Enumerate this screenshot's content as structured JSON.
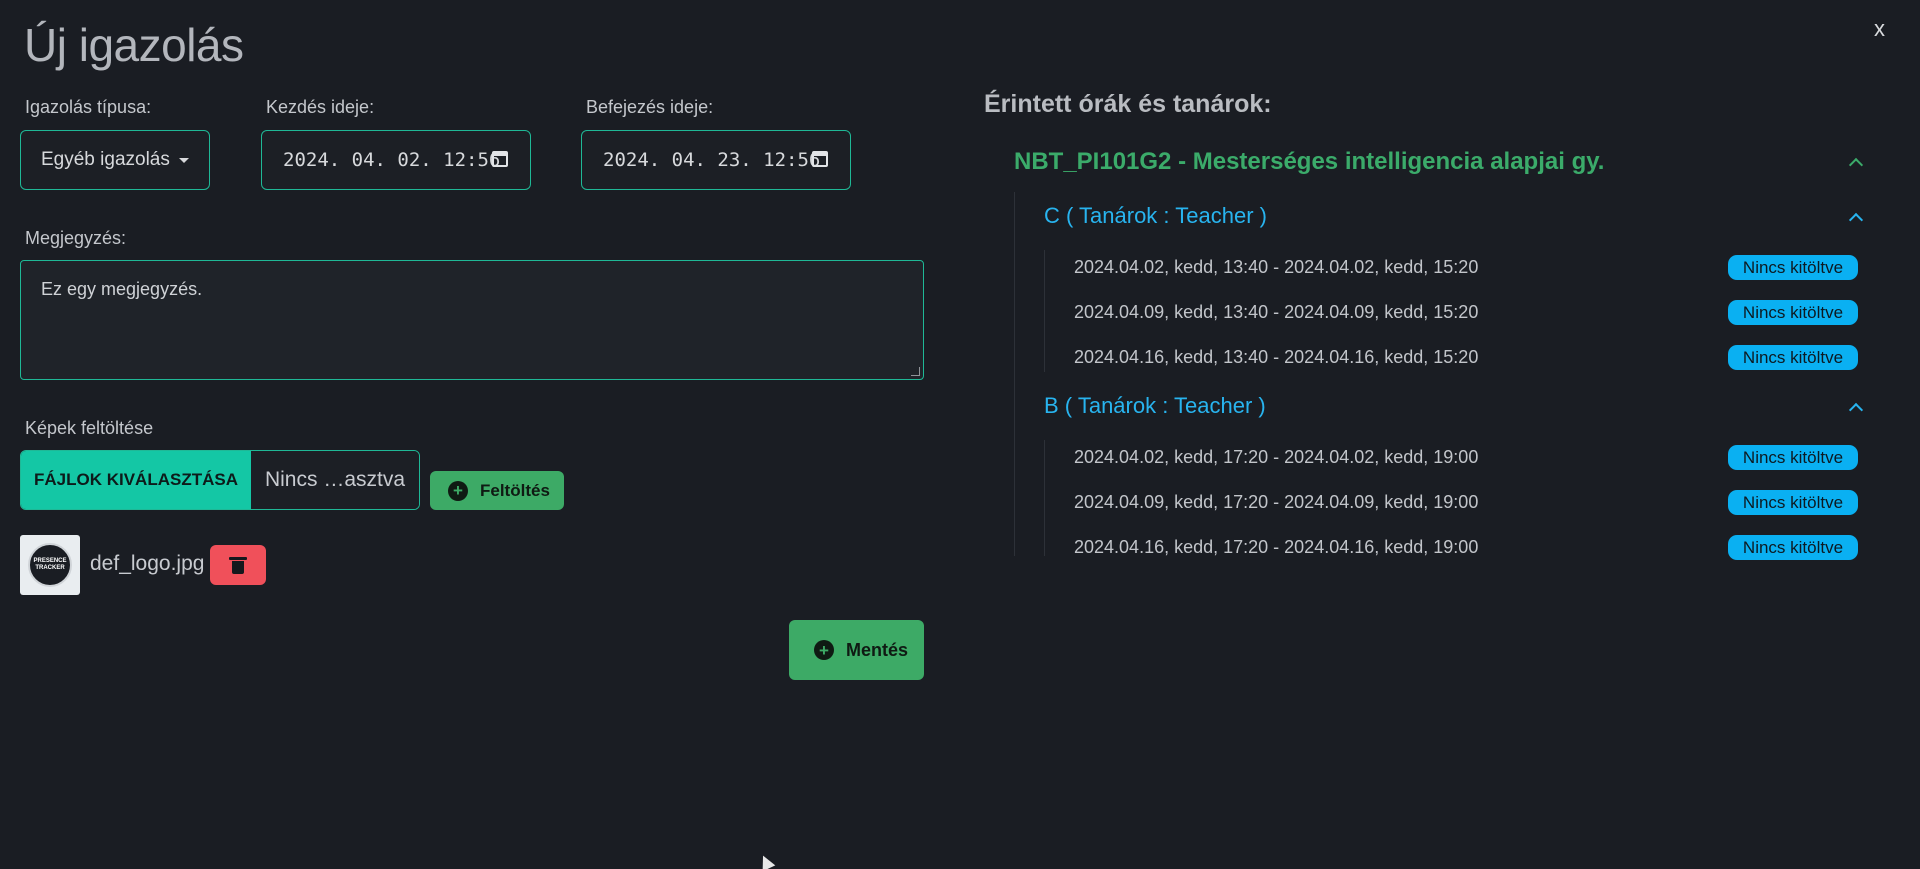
{
  "dialog": {
    "title": "Új igazolás",
    "close_label": "x"
  },
  "form": {
    "type_label": "Igazolás típusa:",
    "type_value": "Egyéb igazolás",
    "start_label": "Kezdés ideje:",
    "start_value": "2024. 04. 02. 12:56",
    "end_label": "Befejezés ideje:",
    "end_value": "2024. 04. 23. 12:56",
    "note_label": "Megjegyzés:",
    "note_value": "Ez egy megjegyzés."
  },
  "upload": {
    "section_label": "Képek feltöltése",
    "choose_button": "FÁJLOK KIVÁLASZTÁSA",
    "no_file_text": "Nincs …asztva",
    "upload_button": "Feltöltés",
    "files": [
      {
        "name": "def_logo.jpg",
        "logo_text_1": "PRESENCE",
        "logo_text_2": "TRACKER"
      }
    ]
  },
  "save_button": "Mentés",
  "affected": {
    "title": "Érintett órák és tanárok:",
    "course": "NBT_PI101G2 - Mesterséges intelligencia alapjai gy.",
    "groups": [
      {
        "title": "C ( Tanárok : Teacher )",
        "sessions": [
          {
            "text": "2024.04.02, kedd, 13:40 - 2024.04.02, kedd, 15:20",
            "status": "Nincs kitöltve"
          },
          {
            "text": "2024.04.09, kedd, 13:40 - 2024.04.09, kedd, 15:20",
            "status": "Nincs kitöltve"
          },
          {
            "text": "2024.04.16, kedd, 13:40 - 2024.04.16, kedd, 15:20",
            "status": "Nincs kitöltve"
          }
        ]
      },
      {
        "title": "B ( Tanárok : Teacher )",
        "sessions": [
          {
            "text": "2024.04.02, kedd, 17:20 - 2024.04.02, kedd, 19:00",
            "status": "Nincs kitöltve"
          },
          {
            "text": "2024.04.09, kedd, 17:20 - 2024.04.09, kedd, 19:00",
            "status": "Nincs kitöltve"
          },
          {
            "text": "2024.04.16, kedd, 17:20 - 2024.04.16, kedd, 19:00",
            "status": "Nincs kitöltve"
          }
        ]
      }
    ]
  },
  "colors": {
    "accent_teal": "#14c7a5",
    "success_green": "#3daa66",
    "info_blue": "#0ab0f2",
    "danger_red": "#f0505a",
    "background": "#1a1d23"
  }
}
